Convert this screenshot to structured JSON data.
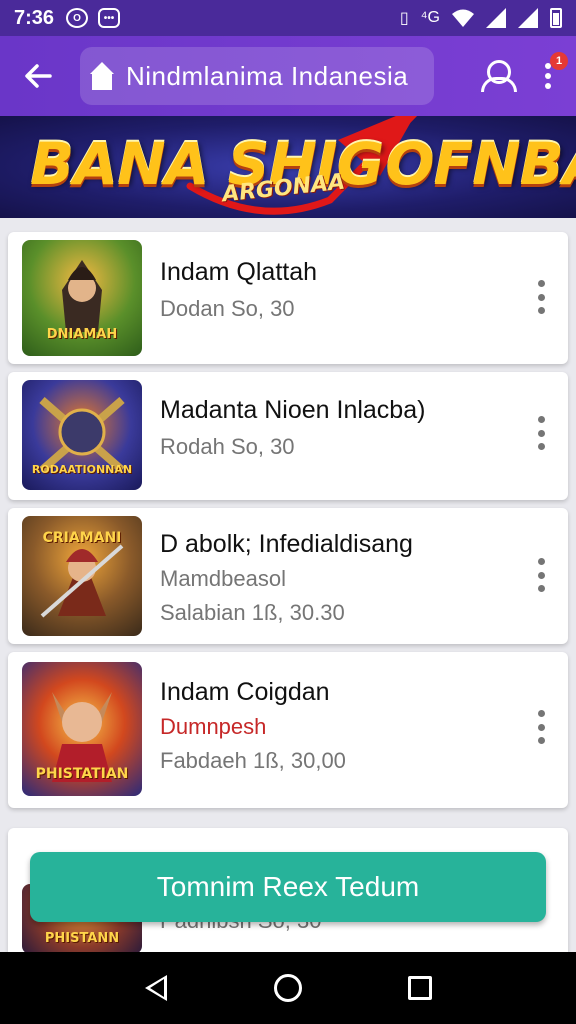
{
  "status_bar": {
    "time": "7:36",
    "left_icons": [
      "notification-icon",
      "message-icon"
    ],
    "right_icons": [
      "vibrate-icon",
      "data-icon",
      "wifi-icon",
      "signal-icon",
      "signal-icon",
      "battery-icon"
    ],
    "data_label": "⁴G"
  },
  "app_bar": {
    "search_text": "Nindmlanima Indanesia",
    "notification_count": "1"
  },
  "banner": {
    "title": "BANA SHIG",
    "title_tail": "OFNBA!!",
    "subtitle": "ARGONAA"
  },
  "items": [
    {
      "title": "Indam Qlattah",
      "line1": "Dodan So, 30",
      "line2": "",
      "thumb_caption": "DNIAMAH",
      "accent": "#2e7d32"
    },
    {
      "title": "Madanta Nioen Inlacba)",
      "line1": "Rodah So, 30",
      "line2": "",
      "thumb_caption": "RODAATIONNAN",
      "accent": "#283593"
    },
    {
      "title": "D abolk; Infedialdisang",
      "line1": "Mamdbeasol",
      "line2": "Salabian 1ß, 30.30",
      "thumb_caption": "CRIAMANI",
      "accent": "#6d4c41"
    },
    {
      "title": "Indam Coigdan",
      "line1": "Dumnpesh",
      "line2": "Fabdaeh 1ß, 30,00",
      "thumb_caption": "PHISTATIAN",
      "accent": "#1565c0"
    },
    {
      "title": "",
      "line1": "Padnibsh So, 30",
      "line2": "",
      "thumb_caption": "PHISTANN",
      "accent": "#4e342e"
    }
  ],
  "fab": {
    "label": "Tomnim Reex Tedum"
  },
  "colors": {
    "primary": "#6a36c8",
    "fab": "#27b39a",
    "badge": "#e53935"
  }
}
